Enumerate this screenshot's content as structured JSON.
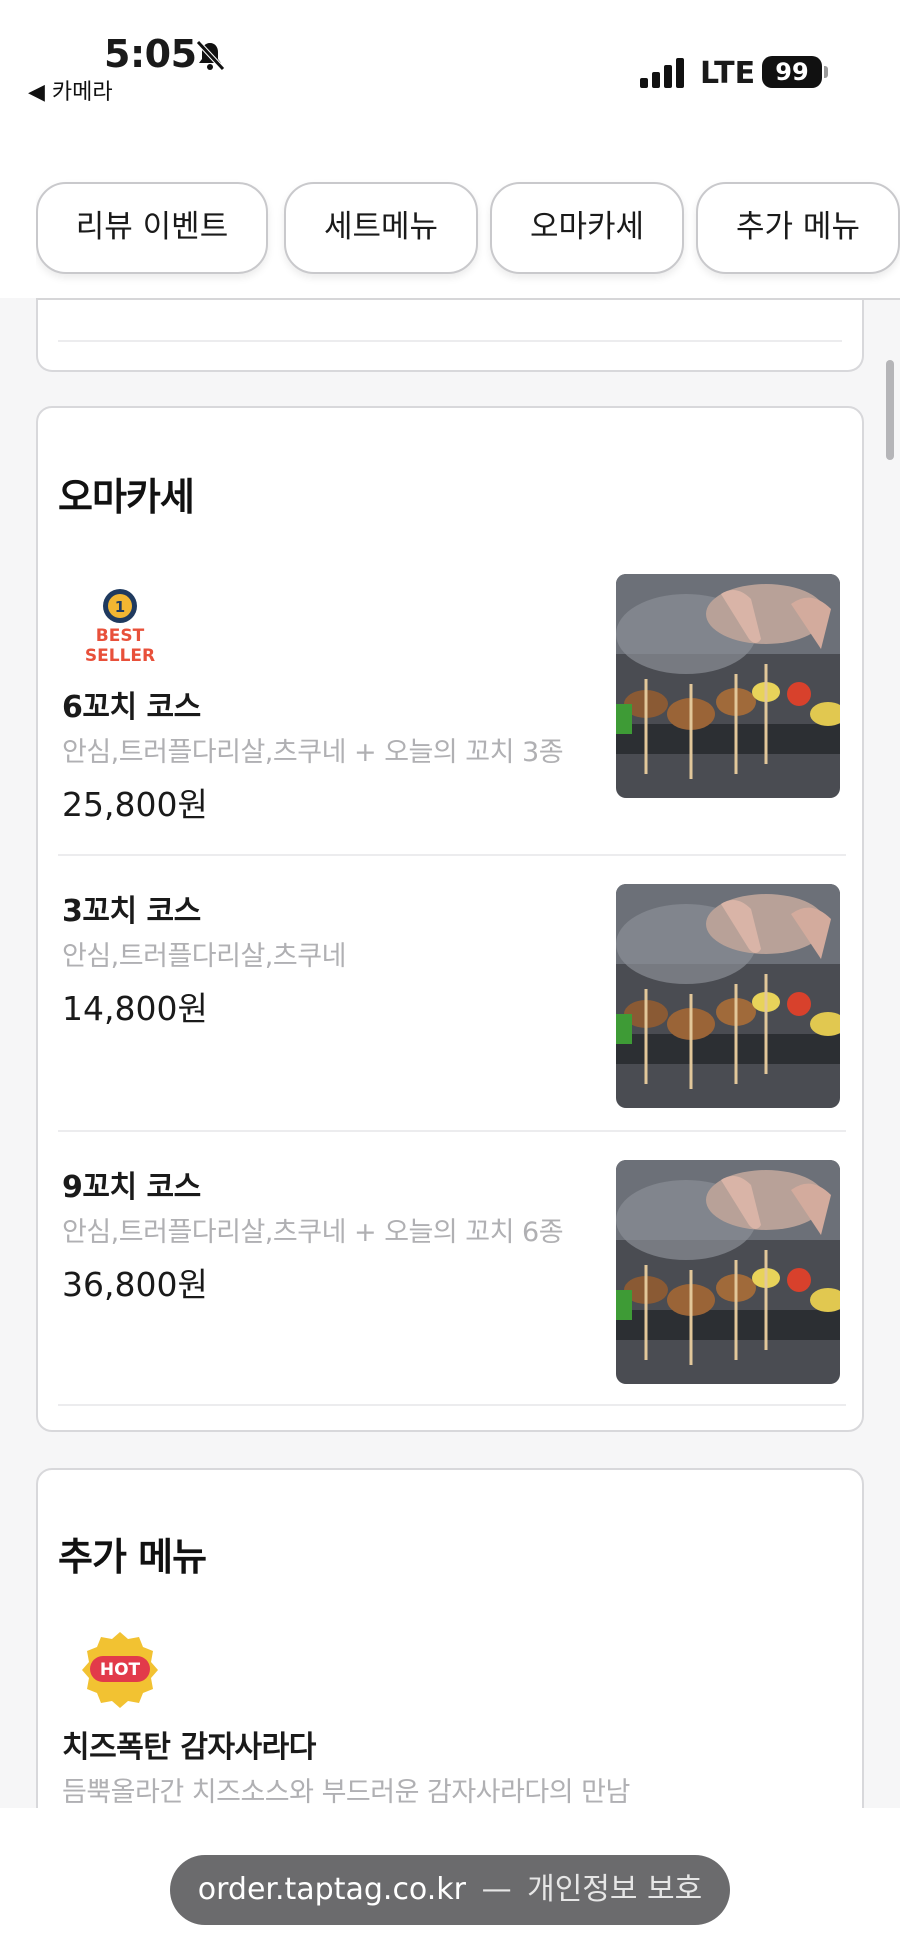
{
  "status_bar": {
    "time": "5:05",
    "back_app": "◀ 카메라",
    "network": "LTE",
    "battery": "99",
    "bell_icon": "bell-slash-icon",
    "signal_icon": "cellular-signal-icon"
  },
  "tabs": [
    {
      "label": "리뷰 이벤트"
    },
    {
      "label": "세트메뉴"
    },
    {
      "label": "오마카세"
    },
    {
      "label": "추가 메뉴"
    }
  ],
  "sections": {
    "omakase": {
      "title": "오마카세",
      "items": [
        {
          "badge": "BEST SELLER",
          "badge_icon": "best-seller-medal-icon",
          "name": "6꼬치 코스",
          "desc": "안심,트러플다리살,츠쿠네 + 오늘의 꼬치 3종",
          "price": "25,800원"
        },
        {
          "name": "3꼬치 코스",
          "desc": "안심,트러플다리살,츠쿠네",
          "price": "14,800원"
        },
        {
          "name": "9꼬치 코스",
          "desc": "안심,트러플다리살,츠쿠네 + 오늘의 꼬치 6종",
          "price": "36,800원"
        }
      ]
    },
    "extra": {
      "title": "추가 메뉴",
      "items": [
        {
          "badge": "HOT",
          "badge_icon": "hot-badge-icon",
          "name": "치즈폭탄 감자사라다",
          "desc": "듬뿍올라간 치즈소스와 부드러운 감자사라다의 만남"
        }
      ]
    }
  },
  "browser": {
    "domain": "order.taptag.co.kr",
    "separator": "—",
    "privacy": "개인정보 보호"
  },
  "colors": {
    "accent_red": "#e8503a",
    "medal_gold": "#f2b632",
    "muted_text": "#b0b0b3"
  }
}
